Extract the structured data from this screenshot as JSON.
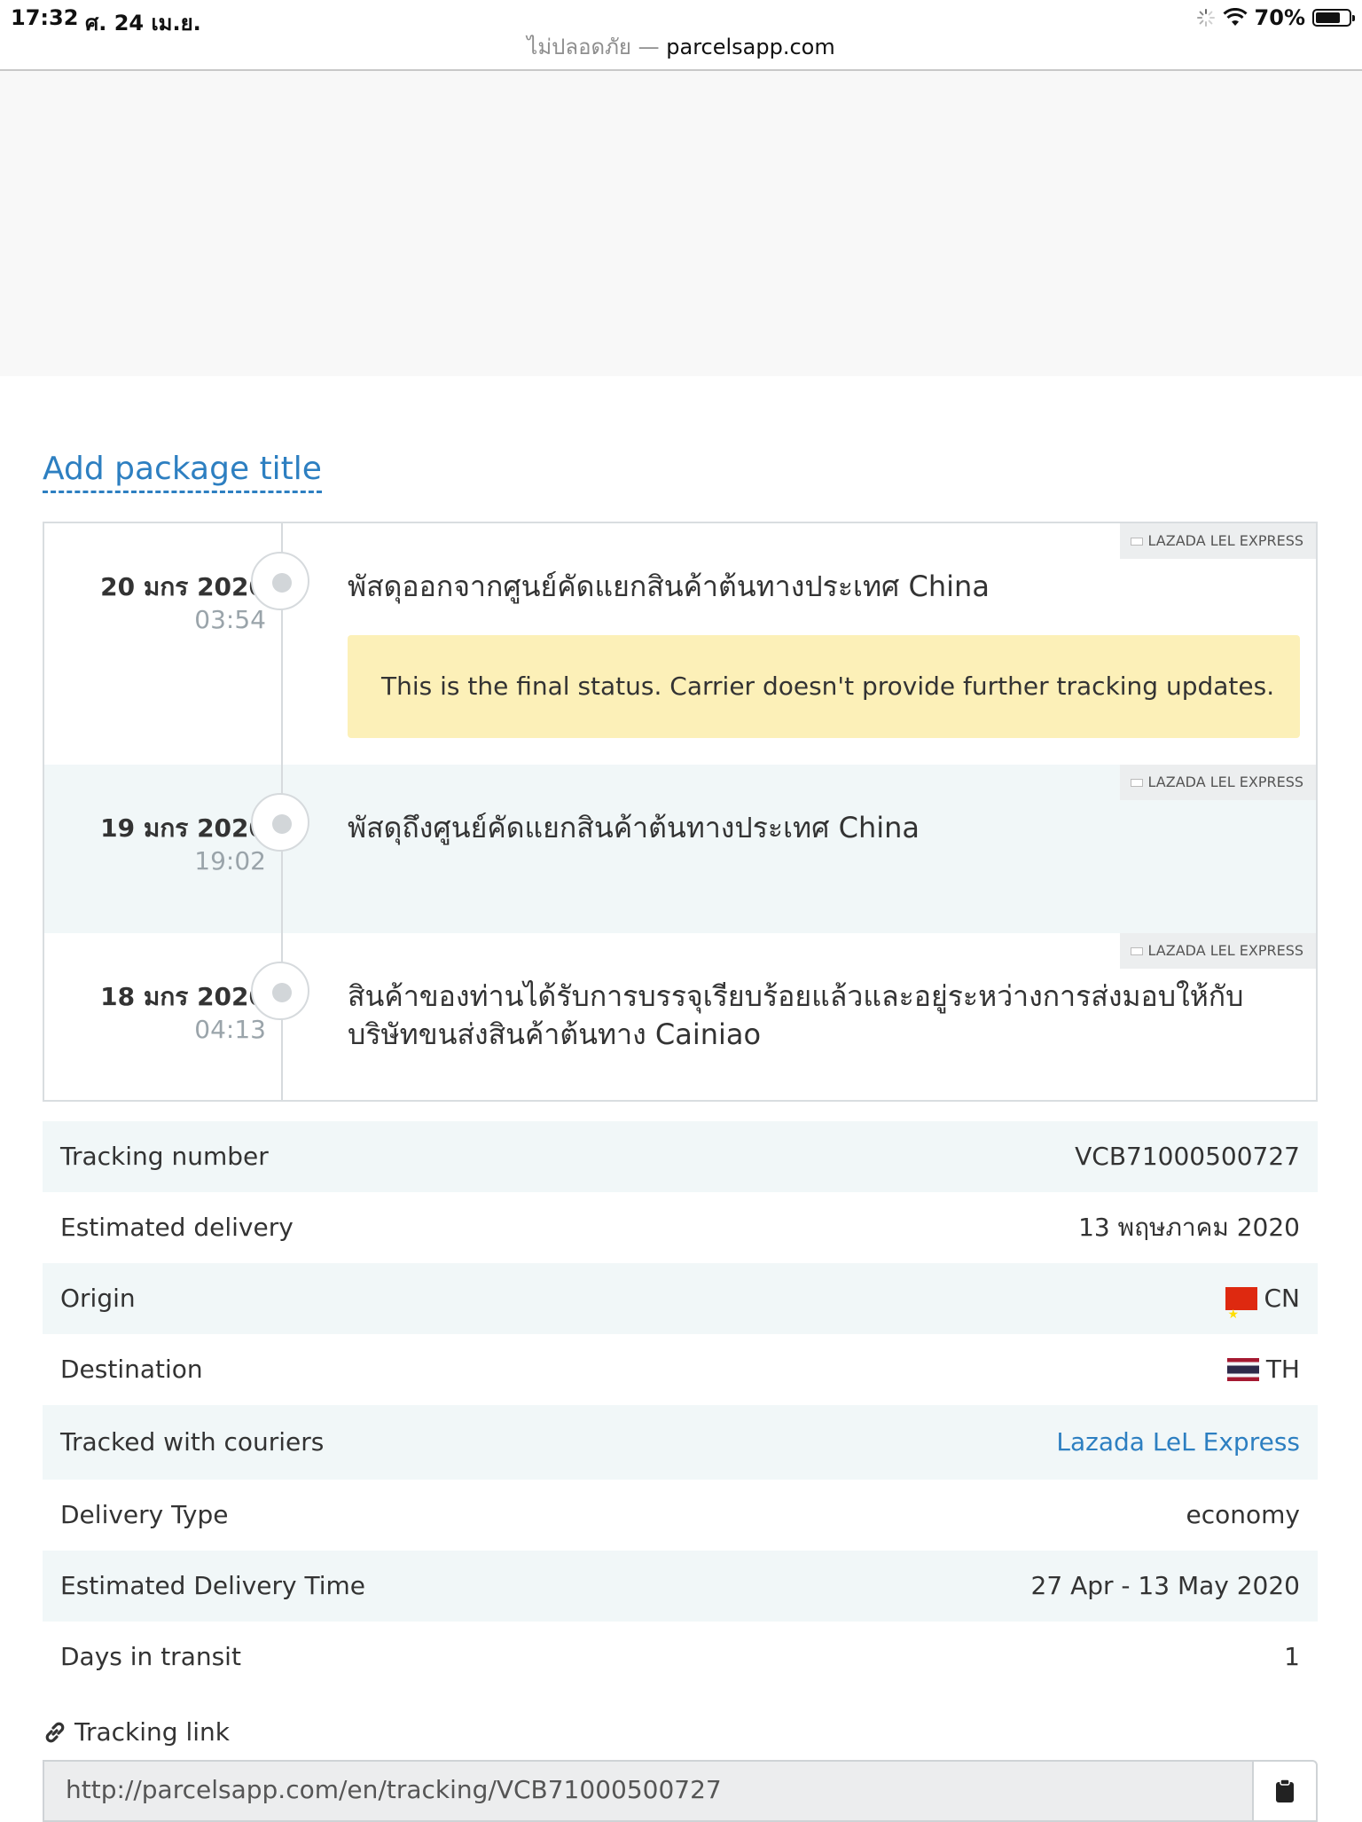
{
  "status_bar": {
    "time": "17:32",
    "date": "ศ. 24 เม.ย.",
    "battery": "70%"
  },
  "browser": {
    "insecure_label": "ไม่ปลอดภัย",
    "separator": "—",
    "host": "parcelsapp.com"
  },
  "package": {
    "add_title_label": "Add package title"
  },
  "events": [
    {
      "date": "20 มกร 2020",
      "time": "03:54",
      "text": "พัสดุออกจากศูนย์คัดแยกสินค้าต้นทางประเทศ China",
      "courier": "LAZADA LEL EXPRESS",
      "note": "This is the final status. Carrier doesn't provide further tracking updates."
    },
    {
      "date": "19 มกร 2020",
      "time": "19:02",
      "text": "พัสดุถึงศูนย์คัดแยกสินค้าต้นทางประเทศ China",
      "courier": "LAZADA LEL EXPRESS"
    },
    {
      "date": "18 มกร 2020",
      "time": "04:13",
      "text": "สินค้าของท่านได้รับการบรรจุเรียบร้อยแล้วและอยู่ระหว่างการส่งมอบให้กับบริษัทขนส่งสินค้าต้นทาง Cainiao",
      "courier": "LAZADA LEL EXPRESS"
    }
  ],
  "details": {
    "tracking_number": {
      "label": "Tracking number",
      "value": "VCB71000500727"
    },
    "estimated_delivery": {
      "label": "Estimated delivery",
      "value": "13 พฤษภาคม 2020"
    },
    "origin": {
      "label": "Origin",
      "value": "CN"
    },
    "destination": {
      "label": "Destination",
      "value": "TH"
    },
    "couriers": {
      "label": "Tracked with couriers",
      "value": "Lazada LeL Express"
    },
    "delivery_type": {
      "label": "Delivery Type",
      "value": "economy"
    },
    "delivery_time": {
      "label": "Estimated Delivery Time",
      "value": "27 Apr - 13 May 2020"
    },
    "days_in_transit": {
      "label": "Days in transit",
      "value": "1"
    }
  },
  "tracking_link": {
    "label": "Tracking link",
    "url": "http://parcelsapp.com/en/tracking/VCB71000500727"
  },
  "icons": {
    "link": "link-icon",
    "clipboard": "clipboard-icon",
    "wifi": "wifi-icon",
    "battery": "battery-icon",
    "loading": "loading-spinner-icon"
  }
}
